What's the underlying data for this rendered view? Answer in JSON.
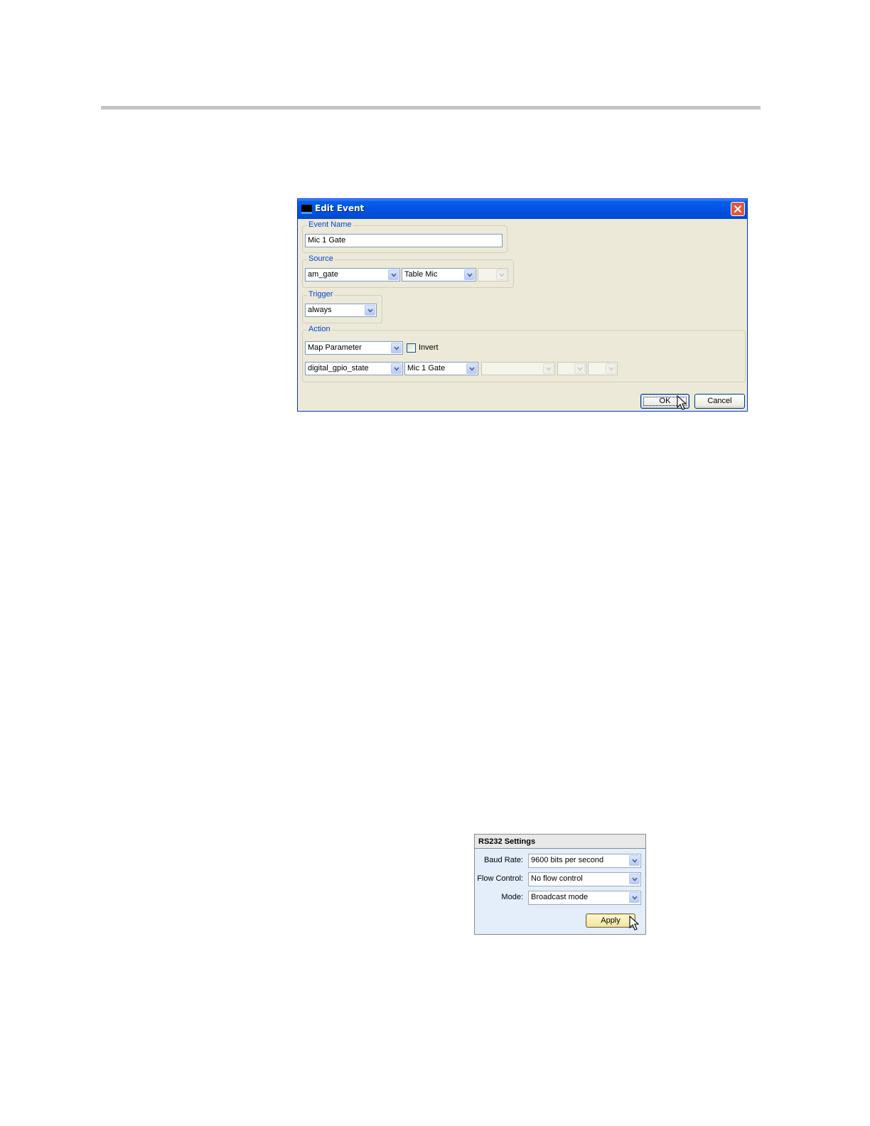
{
  "edit_event": {
    "title": "Edit Event",
    "event_name": {
      "legend": "Event Name",
      "value": "Mic 1 Gate"
    },
    "source": {
      "legend": "Source",
      "combo1": "am_gate",
      "combo2": "Table Mic",
      "combo3": ""
    },
    "trigger": {
      "legend": "Trigger",
      "combo": "always"
    },
    "action": {
      "legend": "Action",
      "type": "Map Parameter",
      "invert_label": "Invert",
      "invert_checked": false,
      "param1": "digital_gpio_state",
      "param2": "Mic 1 Gate",
      "param3": "",
      "param4": "",
      "param5": ""
    },
    "ok_label": "OK",
    "cancel_label": "Cancel",
    "colors": {
      "title_bar": "#0054e3",
      "close_button": "#e1583f",
      "legend_text": "#0046d5",
      "dialog_bg": "#ece9d8"
    }
  },
  "rs232": {
    "title": "RS232 Settings",
    "baud_rate": {
      "label": "Baud Rate:",
      "value": "9600 bits per second"
    },
    "flow_control": {
      "label": "Flow Control:",
      "value": "No flow control"
    },
    "mode": {
      "label": "Mode:",
      "value": "Broadcast mode"
    },
    "apply_label": "Apply",
    "colors": {
      "panel_bg": "#e4eefb",
      "apply_button": "#f3e39c"
    }
  }
}
